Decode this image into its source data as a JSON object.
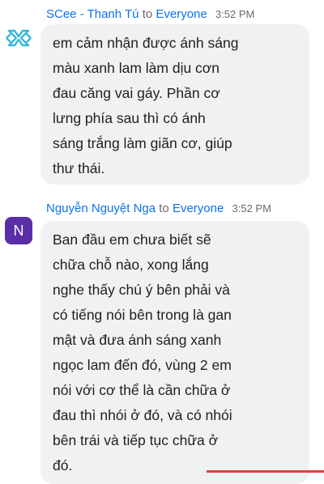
{
  "messages": [
    {
      "sender": "SCee - Thanh Tú",
      "to_word": "to",
      "recipient": "Everyone",
      "time": "3:52 PM",
      "avatar_icon": "scee-logo-icon",
      "lines": [
        "em cảm nhận được ánh sáng",
        "màu xanh lam làm dịu cơn",
        "đau căng vai gáy. Phần cơ",
        "lưng phía sau thì có ánh",
        "sáng trắng làm giãn cơ, giúp",
        "thư thái."
      ]
    },
    {
      "sender": "Nguyễn Nguyệt Nga",
      "to_word": "to",
      "recipient": "Everyone",
      "time": "3:52 PM",
      "avatar_letter": "N",
      "avatar_color": "#5a2ea6",
      "lines": [
        "Ban đầu em chưa biết sẽ",
        "chữa chỗ nào, xong lắng",
        "nghe thấy chú ý bên phải và",
        "có tiếng nói bên trong là gan",
        "mật và đưa ánh sáng xanh",
        "ngọc lam đến đó, vùng 2 em",
        "nói với cơ thể là cần chữa ở",
        "đau thì nhói ở đó, và có nhói",
        "bên trái và tiếp tục chữa ở",
        "đó."
      ]
    }
  ]
}
